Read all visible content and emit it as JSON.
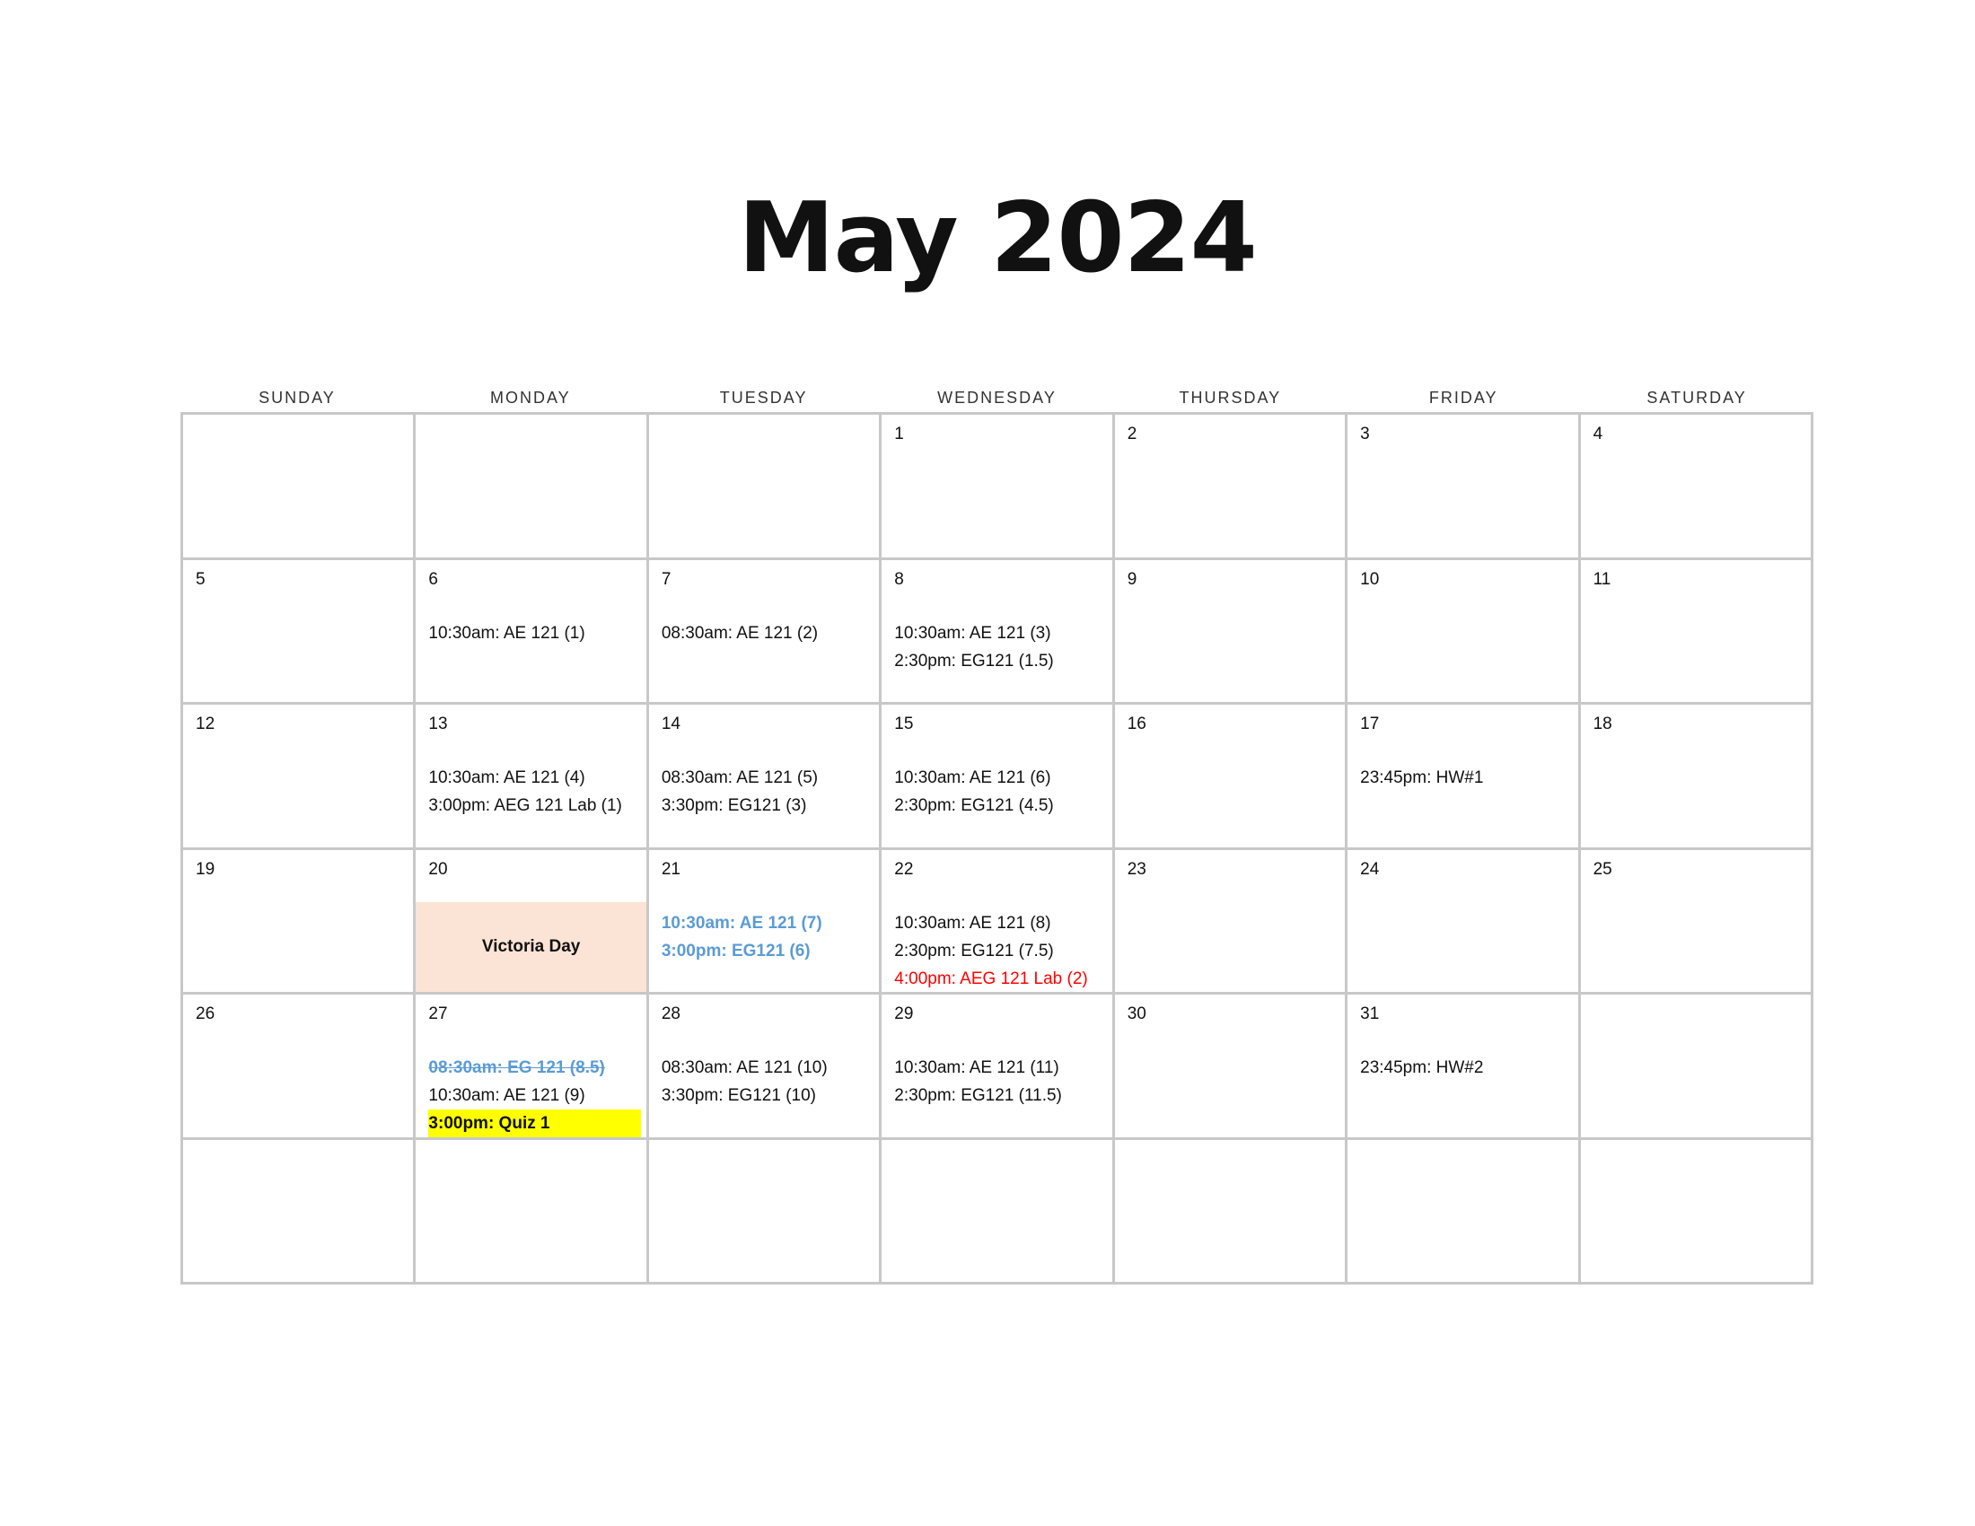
{
  "title": "May 2024",
  "weekdays": [
    "SUNDAY",
    "MONDAY",
    "TUESDAY",
    "WEDNESDAY",
    "THURSDAY",
    "FRIDAY",
    "SATURDAY"
  ],
  "colors": {
    "grid_border": "#c8c8c8",
    "holiday_fill": "#fbe4d5",
    "rescheduled_blue": "#5b9bd5",
    "lab_red": "#ff0000",
    "quiz_highlight": "#ffff00"
  },
  "weeks": [
    [
      {
        "day": "",
        "events": []
      },
      {
        "day": "",
        "events": []
      },
      {
        "day": "",
        "events": []
      },
      {
        "day": "1",
        "events": []
      },
      {
        "day": "2",
        "events": []
      },
      {
        "day": "3",
        "events": []
      },
      {
        "day": "4",
        "events": []
      }
    ],
    [
      {
        "day": "5",
        "events": []
      },
      {
        "day": "6",
        "events": [
          {
            "text": "10:30am: AE 121 (1)",
            "style": "normal"
          }
        ]
      },
      {
        "day": "7",
        "events": [
          {
            "text": "08:30am: AE 121 (2)",
            "style": "normal"
          }
        ]
      },
      {
        "day": "8",
        "events": [
          {
            "text": "10:30am: AE 121 (3)",
            "style": "normal"
          },
          {
            "text": "2:30pm: EG121 (1.5)",
            "style": "normal"
          }
        ]
      },
      {
        "day": "9",
        "events": []
      },
      {
        "day": "10",
        "events": []
      },
      {
        "day": "11",
        "events": []
      }
    ],
    [
      {
        "day": "12",
        "events": []
      },
      {
        "day": "13",
        "events": [
          {
            "text": "10:30am: AE 121 (4)",
            "style": "normal"
          },
          {
            "text": "3:00pm: AEG 121 Lab (1)",
            "style": "normal"
          }
        ]
      },
      {
        "day": "14",
        "events": [
          {
            "text": "08:30am: AE 121 (5)",
            "style": "normal"
          },
          {
            "text": "3:30pm: EG121 (3)",
            "style": "normal"
          }
        ]
      },
      {
        "day": "15",
        "events": [
          {
            "text": "10:30am: AE 121 (6)",
            "style": "normal"
          },
          {
            "text": "2:30pm: EG121 (4.5)",
            "style": "normal"
          }
        ]
      },
      {
        "day": "16",
        "events": []
      },
      {
        "day": "17",
        "events": [
          {
            "text": "23:45pm: HW#1",
            "style": "normal"
          }
        ]
      },
      {
        "day": "18",
        "events": []
      }
    ],
    [
      {
        "day": "19",
        "events": []
      },
      {
        "day": "20",
        "holiday": "Victoria Day",
        "events": []
      },
      {
        "day": "21",
        "events": [
          {
            "text": "10:30am: AE 121 (7)",
            "style": "blue"
          },
          {
            "text": "3:00pm: EG121 (6)",
            "style": "blue"
          }
        ]
      },
      {
        "day": "22",
        "events": [
          {
            "text": "10:30am: AE 121 (8)",
            "style": "normal"
          },
          {
            "text": "2:30pm: EG121 (7.5)",
            "style": "normal"
          },
          {
            "text": "4:00pm: AEG 121 Lab (2)",
            "style": "red"
          }
        ]
      },
      {
        "day": "23",
        "events": []
      },
      {
        "day": "24",
        "events": []
      },
      {
        "day": "25",
        "events": []
      }
    ],
    [
      {
        "day": "26",
        "events": []
      },
      {
        "day": "27",
        "events": [
          {
            "text": "08:30am: EG 121 (8.5)",
            "style": "strike"
          },
          {
            "text": "10:30am: AE 121 (9)",
            "style": "normal"
          },
          {
            "text": "3:00pm: Quiz 1",
            "style": "highlight"
          }
        ]
      },
      {
        "day": "28",
        "events": [
          {
            "text": "08:30am: AE 121 (10)",
            "style": "normal"
          },
          {
            "text": "3:30pm: EG121 (10)",
            "style": "normal"
          }
        ]
      },
      {
        "day": "29",
        "events": [
          {
            "text": "10:30am: AE 121 (11)",
            "style": "normal"
          },
          {
            "text": "2:30pm: EG121 (11.5)",
            "style": "normal"
          }
        ]
      },
      {
        "day": "30",
        "events": []
      },
      {
        "day": "31",
        "events": [
          {
            "text": "23:45pm: HW#2",
            "style": "normal"
          }
        ]
      },
      {
        "day": "",
        "events": []
      }
    ],
    [
      {
        "day": "",
        "events": []
      },
      {
        "day": "",
        "events": []
      },
      {
        "day": "",
        "events": []
      },
      {
        "day": "",
        "events": []
      },
      {
        "day": "",
        "events": []
      },
      {
        "day": "",
        "events": []
      },
      {
        "day": "",
        "events": []
      }
    ]
  ]
}
